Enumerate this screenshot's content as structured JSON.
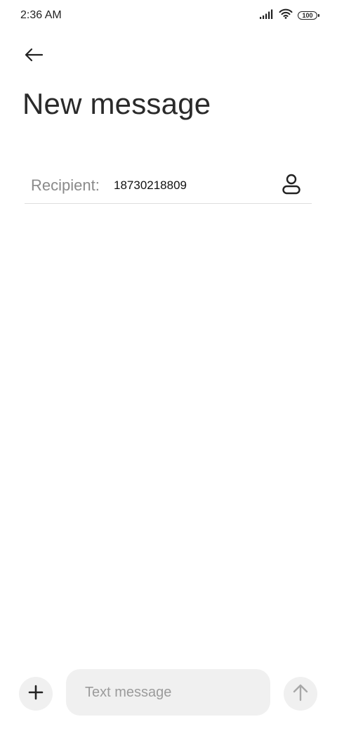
{
  "status_bar": {
    "time": "2:36 AM",
    "battery_level": "100",
    "icons": [
      "signal-icon",
      "wifi-icon",
      "battery-icon"
    ]
  },
  "header": {
    "back_icon": "arrow-left-icon",
    "title": "New message"
  },
  "recipient": {
    "label": "Recipient:",
    "value": "18730218809",
    "contact_icon": "person-icon"
  },
  "composer": {
    "add_icon": "plus-icon",
    "placeholder": "Text message",
    "send_icon": "arrow-up-icon"
  },
  "colors": {
    "background": "#ffffff",
    "pill_background": "#f0f0f0",
    "label_gray": "#8a8a8a",
    "send_icon_gray": "#a8a8a8"
  }
}
